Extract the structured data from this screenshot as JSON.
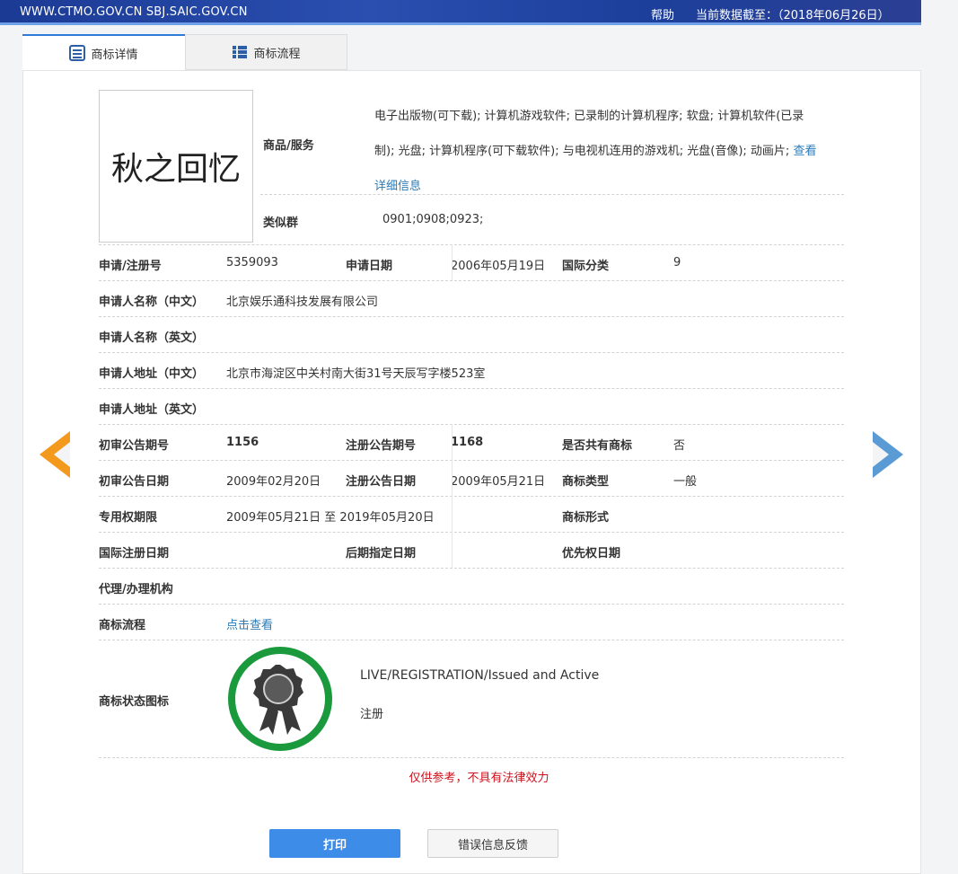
{
  "header": {
    "site_urls": "WWW.CTMO.GOV.CN SBJ.SAIC.GOV.CN",
    "help_label": "帮助",
    "data_date": "当前数据截至：（2018年06月26日）"
  },
  "tabs": [
    {
      "label": "商标详情",
      "icon": "document-list-icon",
      "active": true
    },
    {
      "label": "商标流程",
      "icon": "grid-list-icon",
      "active": false
    }
  ],
  "trademark": {
    "image_text": "秋之回忆",
    "goods_label": "商品/服务",
    "goods_line1": "电子出版物(可下载); 计算机游戏软件; 已录制的计算机程序; 软盘; 计算机软件(已录",
    "goods_line2": "制); 光盘; 计算机程序(可下载软件); 与电视机连用的游戏机; 光盘(音像); 动画片;",
    "goods_more_link": "查看",
    "goods_detail_link": "详细信息",
    "similar_group_label": "类似群",
    "similar_group_value": "0901;0908;0923;"
  },
  "fields": {
    "reg_no_label": "申请/注册号",
    "reg_no": "5359093",
    "apply_date_label": "申请日期",
    "apply_date": "2006年05月19日",
    "intl_class_label": "国际分类",
    "intl_class": "9",
    "applicant_cn_label": "申请人名称（中文）",
    "applicant_cn": "北京娱乐通科技发展有限公司",
    "applicant_en_label": "申请人名称（英文）",
    "applicant_en": "",
    "address_cn_label": "申请人地址（中文）",
    "address_cn": "北京市海淀区中关村南大街31号天辰写字楼523室",
    "address_en_label": "申请人地址（英文）",
    "address_en": "",
    "prelim_no_label": "初审公告期号",
    "prelim_no": "1156",
    "reg_pub_no_label": "注册公告期号",
    "reg_pub_no": "1168",
    "shared_label": "是否共有商标",
    "shared": "否",
    "prelim_date_label": "初审公告日期",
    "prelim_date": "2009年02月20日",
    "reg_pub_date_label": "注册公告日期",
    "reg_pub_date": "2009年05月21日",
    "tm_type_label": "商标类型",
    "tm_type": "一般",
    "exclusive_period_label": "专用权期限",
    "exclusive_period": "2009年05月21日 至 2019年05月20日",
    "tm_form_label": "商标形式",
    "intl_reg_date_label": "国际注册日期",
    "later_designation_label": "后期指定日期",
    "priority_date_label": "优先权日期",
    "agent_label": "代理/办理机构",
    "process_label": "商标流程",
    "process_link": "点击查看",
    "status_icon_label": "商标状态图标",
    "status_en": "LIVE/REGISTRATION/Issued and Active",
    "status_cn": "注册"
  },
  "disclaimer": "仅供参考，不具有法律效力",
  "buttons": {
    "print": "打印",
    "feedback": "错误信息反馈"
  },
  "colors": {
    "header_bg": "#1c3f9b",
    "tab_accent": "#2f7bd8",
    "link": "#2a7bb8",
    "prev_arrow": "#f39a1e",
    "next_arrow": "#5b9bd5",
    "status_ring": "#1a9a3c",
    "disclaimer": "#d0101b",
    "print_button": "#3d8ce8"
  }
}
